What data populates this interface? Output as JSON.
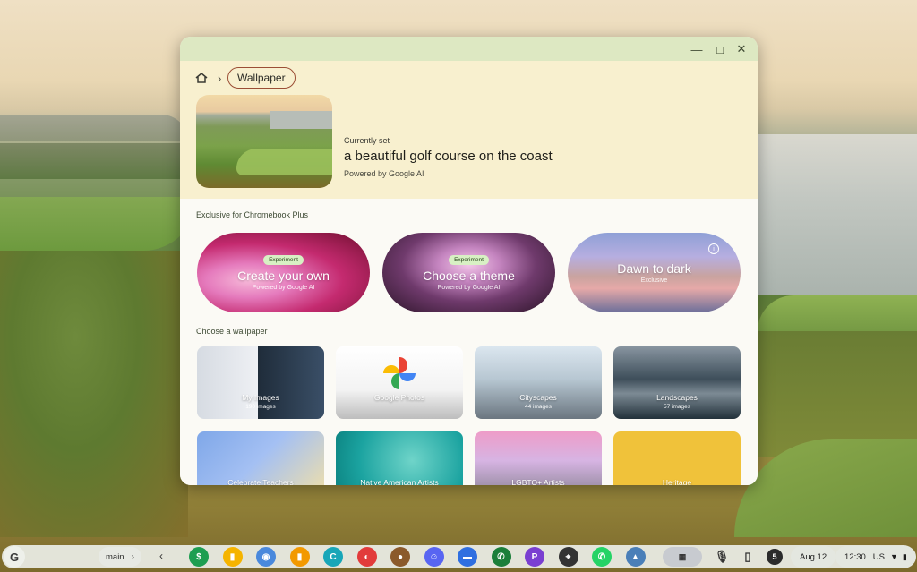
{
  "window": {
    "controls": {
      "minimize": "—",
      "maximize": "□",
      "close": "✕"
    },
    "breadcrumb": {
      "current": "Wallpaper"
    }
  },
  "current": {
    "label": "Currently set",
    "title": "a beautiful golf course on the coast",
    "powered": "Powered by Google AI"
  },
  "sections": {
    "exclusive": "Exclusive for Chromebook Plus",
    "choose": "Choose a wallpaper"
  },
  "pills": [
    {
      "badge": "Experiment",
      "title": "Create your own",
      "sub": "Powered by Google AI"
    },
    {
      "badge": "Experiment",
      "title": "Choose a theme",
      "sub": "Powered by Google AI"
    },
    {
      "title": "Dawn to dark",
      "sub": "Exclusive",
      "info": "i"
    }
  ],
  "tiles": [
    {
      "name": "My Images",
      "count": "190 images"
    },
    {
      "name": "Google Photos"
    },
    {
      "name": "Cityscapes",
      "count": "44 images"
    },
    {
      "name": "Landscapes",
      "count": "57 images"
    },
    {
      "name": "Celebrate Teachers"
    },
    {
      "name": "Native American Artists"
    },
    {
      "name": "LGBTQ+ Artists"
    },
    {
      "name": "Heritage"
    }
  ],
  "shelf": {
    "launcher": "G",
    "desk": "main",
    "desk_arrow": "›",
    "back": "‹",
    "notifications": "5",
    "date": "Aug 12",
    "time": "12:30",
    "locale": "US",
    "apps": [
      {
        "icon": "sheets-icon",
        "color": "#1e9e51",
        "glyph": "$"
      },
      {
        "icon": "keep-icon",
        "color": "#f5b400",
        "glyph": "▮"
      },
      {
        "icon": "chrome-icon",
        "color": "#4a89dc",
        "glyph": "◉"
      },
      {
        "icon": "analytics-icon",
        "color": "#f29900",
        "glyph": "▮"
      },
      {
        "icon": "canvas-icon",
        "color": "#18a6b8",
        "glyph": "C"
      },
      {
        "icon": "bookmark-app-icon",
        "color": "#e23b3b",
        "glyph": "◐"
      },
      {
        "icon": "app-avatar-icon",
        "color": "#8b5a2b",
        "glyph": "●"
      },
      {
        "icon": "discord-icon",
        "color": "#5865f2",
        "glyph": "☺"
      },
      {
        "icon": "messages-icon",
        "color": "#2f6fe0",
        "glyph": "▬"
      },
      {
        "icon": "phone-icon",
        "color": "#1b7f3a",
        "glyph": "✆"
      },
      {
        "icon": "podcast-icon",
        "color": "#7a3fd1",
        "glyph": "P"
      },
      {
        "icon": "maps-pin-icon",
        "color": "#333333",
        "glyph": "⌖"
      },
      {
        "icon": "whatsapp-icon",
        "color": "#25d366",
        "glyph": "✆"
      },
      {
        "icon": "wallpaper-app-icon",
        "color": "#4a7fb8",
        "glyph": "▲"
      }
    ],
    "colors": {
      "accent": "#9b4e35",
      "titlebar": "#dde8c2",
      "header": "#f8f0cf"
    }
  }
}
